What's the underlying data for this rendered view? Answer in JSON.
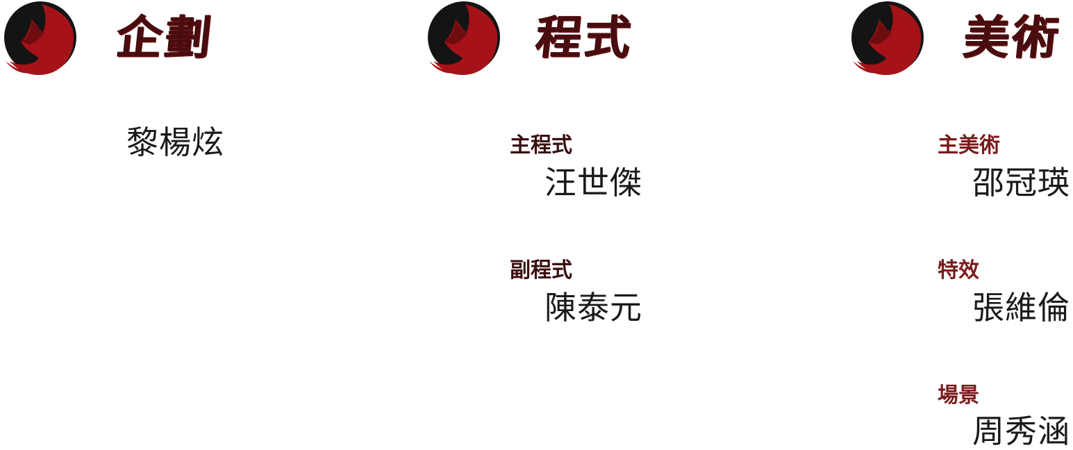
{
  "sections": [
    {
      "title": "企劃",
      "logo": "fox-emblem-icon",
      "entries": [
        {
          "role": "",
          "name": "黎楊炫"
        }
      ]
    },
    {
      "title": "程式",
      "logo": "fox-emblem-icon",
      "entries": [
        {
          "role": "主程式",
          "name": "汪世傑"
        },
        {
          "role": "副程式",
          "name": "陳泰元"
        }
      ]
    },
    {
      "title": "美術",
      "logo": "fox-emblem-icon",
      "entries": [
        {
          "role": "主美術",
          "name": "邵冠瑛"
        },
        {
          "role": "特效",
          "name": "張維倫"
        },
        {
          "role": "場景",
          "name": "周秀涵"
        }
      ]
    }
  ],
  "colors": {
    "heading": "#4a0d0f",
    "emblem_red": "#b01217",
    "emblem_black": "#111111",
    "role_program": "#3a0f10",
    "role_art": "#7a1a1c",
    "name": "#1a1a1a",
    "background": "#ffffff"
  }
}
